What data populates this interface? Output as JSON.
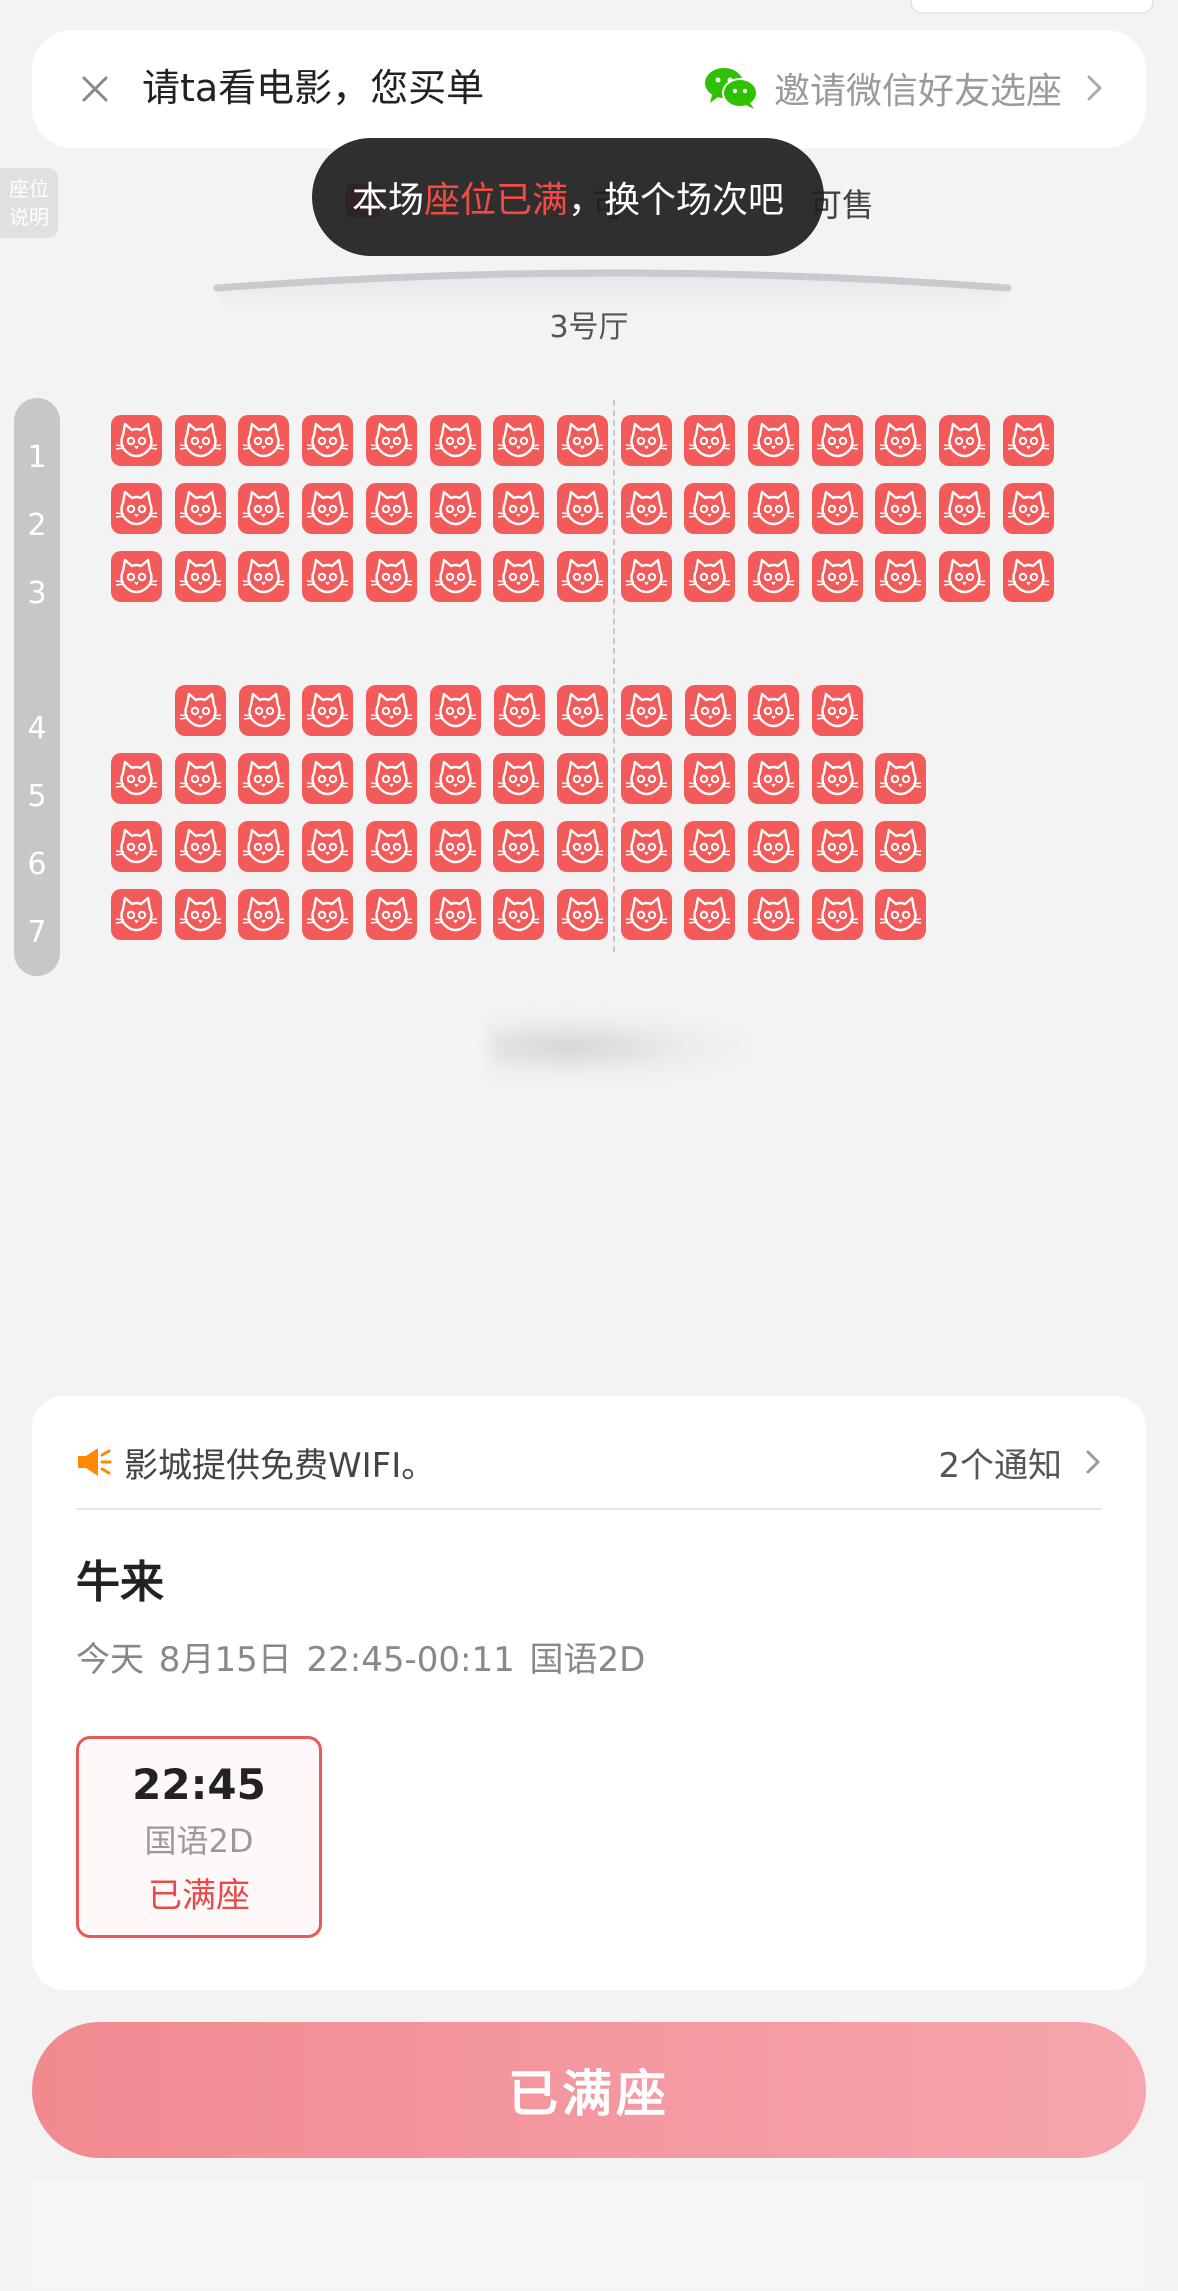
{
  "header": {
    "title": "请ta看电影，您买单",
    "invite_label": "邀请微信好友选座",
    "seat_legend_button": "座位\n说明"
  },
  "toast": {
    "prefix": "本场",
    "highlight": "座位已满",
    "suffix": "，换个场次吧"
  },
  "legend_behind_toast": {
    "left_fragment": "可",
    "right_fragment": "可售"
  },
  "hall_name": "3号厅",
  "seat_map": {
    "row_labels": [
      "1",
      "2",
      "3",
      "4",
      "5",
      "6",
      "7"
    ],
    "rows": [
      {
        "label": "1",
        "seat_count": 15,
        "status": "sold"
      },
      {
        "label": "2",
        "seat_count": 15,
        "status": "sold"
      },
      {
        "label": "3",
        "seat_count": 15,
        "status": "sold"
      },
      {
        "label": "4",
        "seat_count": 11,
        "status": "sold"
      },
      {
        "label": "5",
        "seat_count": 13,
        "status": "sold"
      },
      {
        "label": "6",
        "seat_count": 13,
        "status": "sold"
      },
      {
        "label": "7",
        "seat_count": 13,
        "status": "sold"
      }
    ],
    "sold_seat_color": "#f35b5b",
    "seat_icon": "cat-face-icon"
  },
  "info": {
    "notice_text": "影城提供免费WIFI。",
    "notice_count": "2个通知",
    "movie_title": "牛来",
    "movie_meta": "今天 8月15日 22:45-00:11 国语2D",
    "showtime": {
      "time": "22:45",
      "language": "国语2D",
      "status": "已满座"
    }
  },
  "bottom_button": {
    "label": "已满座"
  },
  "colors": {
    "accent_red": "#e84a4a",
    "wechat_green": "#2dc100",
    "speaker_orange": "#ff8a00"
  }
}
